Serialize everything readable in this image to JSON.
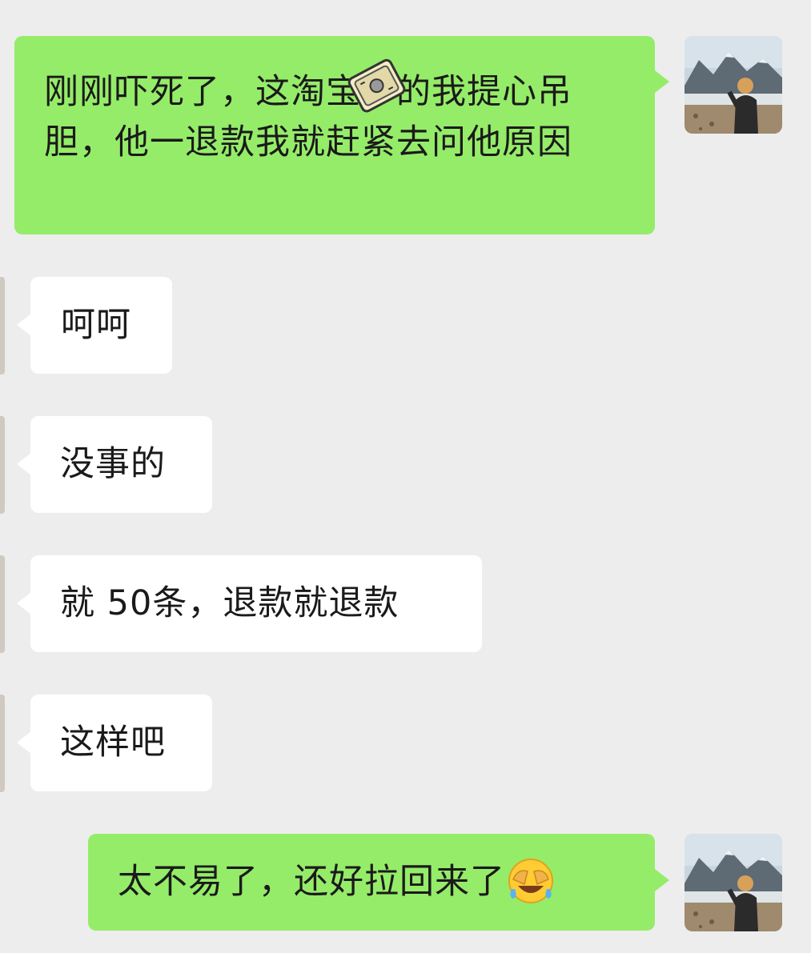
{
  "messages": [
    {
      "from": "me",
      "text": "刚刚吓死了，这淘宝干的我提心吊胆，他一退款我就赶紧去问他原因"
    },
    {
      "from": "other",
      "text": "呵呵"
    },
    {
      "from": "other",
      "text": "没事的"
    },
    {
      "from": "other",
      "text": "就 50条，退款就退款"
    },
    {
      "from": "other",
      "text": "这样吧"
    },
    {
      "from": "me",
      "text": "太不易了，还好拉回来了",
      "emoji": "face-with-tears-of-joy-facepalm"
    }
  ],
  "colors": {
    "background": "#ededed",
    "sent_bubble": "#95ec69",
    "received_bubble": "#ffffff",
    "text": "#1a1a1a"
  },
  "icons": {
    "my_avatar": "landscape-avatar-icon",
    "sticker": "cleaning-sponge-sticker-icon",
    "emoji": "crying-laughing-emoji-icon"
  }
}
